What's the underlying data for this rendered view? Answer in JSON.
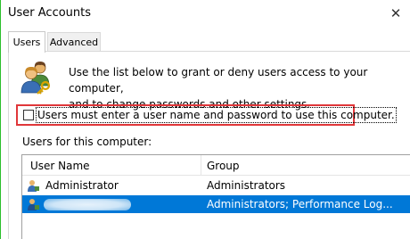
{
  "window": {
    "title": "User Accounts",
    "close_glyph": "✕"
  },
  "tabs": [
    {
      "label": "Users",
      "active": true
    },
    {
      "label": "Advanced",
      "active": false
    }
  ],
  "intro": {
    "line1": "Use the list below to grant or deny users access to your computer,",
    "line2": "and to change passwords and other settings."
  },
  "require_login": {
    "label": "Users must enter a user name and password to use this computer.",
    "checked": false
  },
  "users_section": {
    "label": "Users for this computer:"
  },
  "user_list": {
    "columns": [
      "User Name",
      "Group"
    ],
    "rows": [
      {
        "name": "Administrator",
        "group": "Administrators",
        "selected": false
      },
      {
        "name": "",
        "group": "Administrators; Performance Log...",
        "selected": true
      }
    ]
  },
  "colors": {
    "selection": "#0078d7",
    "highlight_border": "#e0373a",
    "window_accent": "#2bbf2b"
  }
}
